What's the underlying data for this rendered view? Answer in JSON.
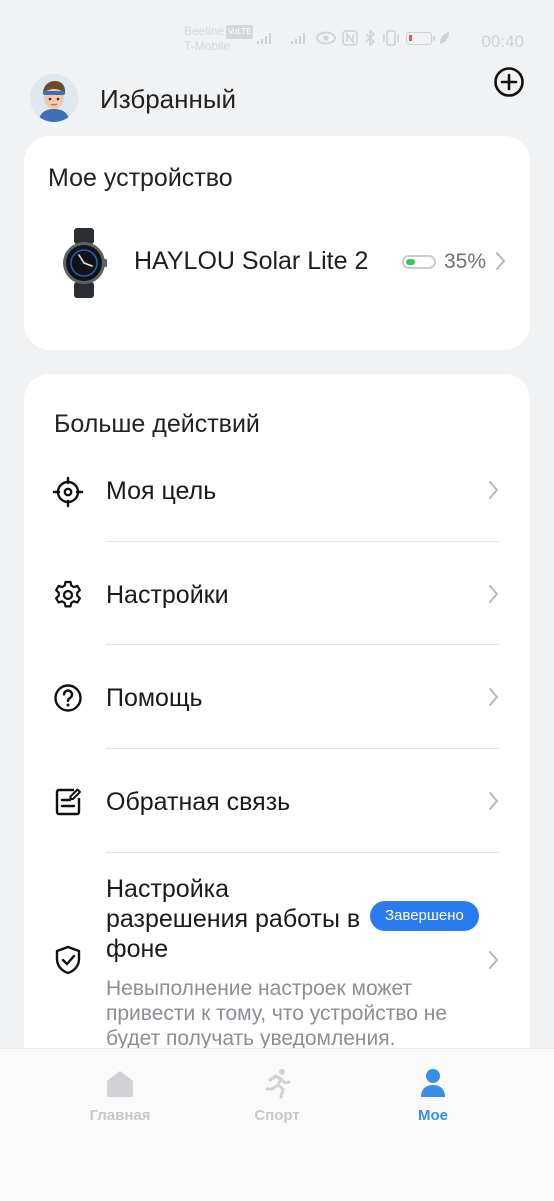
{
  "status_bar": {
    "carrier_1": "Beeline",
    "volte": "VoLTE",
    "carrier_2": "T-Mobile",
    "time": "00:40"
  },
  "header": {
    "title": "Избранный"
  },
  "device_card": {
    "title": "Мое устройство",
    "device_name": "HAYLOU Solar Lite 2",
    "battery_percent": "35%",
    "battery_level": 0.35,
    "battery_color": "#34c759"
  },
  "actions": {
    "title": "Больше действий",
    "items": [
      {
        "label": "Моя цель",
        "icon": "target-icon"
      },
      {
        "label": "Настройки",
        "icon": "gear-icon"
      },
      {
        "label": "Помощь",
        "icon": "help-circle-icon"
      },
      {
        "label": "Обратная связь",
        "icon": "feedback-icon"
      }
    ],
    "background": {
      "title": "Настройка разрешения работы в фоне",
      "badge": "Завершено",
      "badge_color": "#2b7bf0",
      "description": "Невыполнение настроек может привести к тому, что устройство не будет получать уведомления.",
      "icon": "shield-check-icon"
    }
  },
  "bottom_nav": {
    "items": [
      {
        "label": "Главная",
        "icon": "home-icon",
        "active": false
      },
      {
        "label": "Спорт",
        "icon": "running-icon",
        "active": false
      },
      {
        "label": "Мое",
        "icon": "person-icon",
        "active": true
      }
    ],
    "active_color": "#3a8eea",
    "inactive_color": "#c6c8cc"
  }
}
